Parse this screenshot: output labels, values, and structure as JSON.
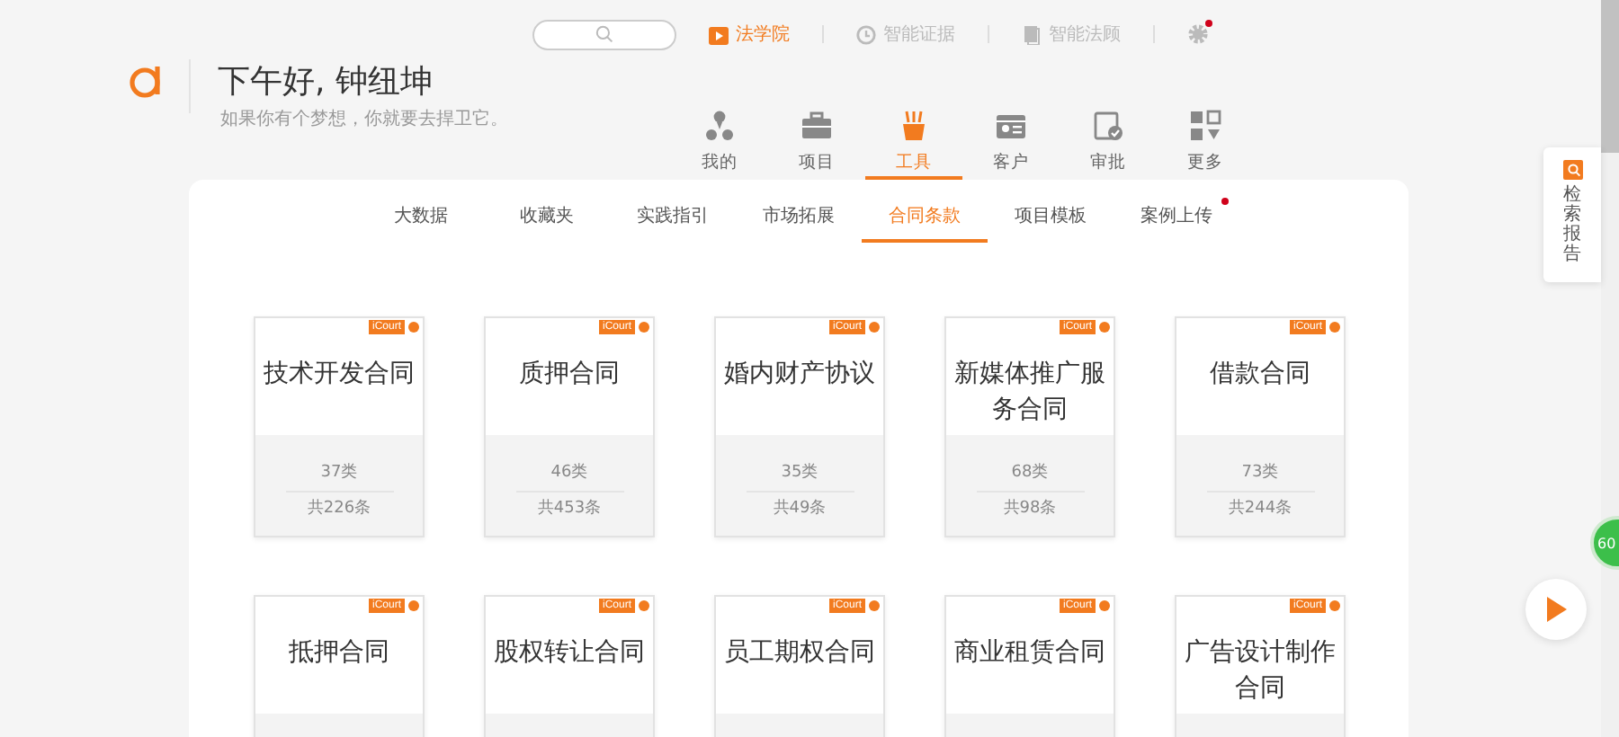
{
  "header": {
    "greeting": "下午好, 钟纽坤",
    "motto": "如果你有个梦想，你就要去捍卫它。"
  },
  "top_links": [
    {
      "label": "法学院",
      "selected": true
    },
    {
      "label": "智能证据",
      "selected": false
    },
    {
      "label": "智能法顾",
      "selected": false
    }
  ],
  "settings": {
    "notification": true
  },
  "nav": [
    {
      "label": "我的",
      "selected": false
    },
    {
      "label": "项目",
      "selected": false
    },
    {
      "label": "工具",
      "selected": true
    },
    {
      "label": "客户",
      "selected": false
    },
    {
      "label": "审批",
      "selected": false
    },
    {
      "label": "更多",
      "selected": false
    }
  ],
  "tabs": [
    {
      "label": "大数据",
      "selected": false,
      "dot": false
    },
    {
      "label": "收藏夹",
      "selected": false,
      "dot": false
    },
    {
      "label": "实践指引",
      "selected": false,
      "dot": false
    },
    {
      "label": "市场拓展",
      "selected": false,
      "dot": false
    },
    {
      "label": "合同条款",
      "selected": true,
      "dot": false
    },
    {
      "label": "项目模板",
      "selected": false,
      "dot": false
    },
    {
      "label": "案例上传",
      "selected": false,
      "dot": true
    }
  ],
  "cards": [
    {
      "title": "技术开发合同",
      "tag": "iCourt",
      "categories": "37类",
      "total": "共226条"
    },
    {
      "title": "质押合同",
      "tag": "iCourt",
      "categories": "46类",
      "total": "共453条"
    },
    {
      "title": "婚内财产协议",
      "tag": "iCourt",
      "categories": "35类",
      "total": "共49条"
    },
    {
      "title": "新媒体推广服务合同",
      "tag": "iCourt",
      "categories": "68类",
      "total": "共98条"
    },
    {
      "title": "借款合同",
      "tag": "iCourt",
      "categories": "73类",
      "total": "共244条"
    },
    {
      "title": "抵押合同",
      "tag": "iCourt"
    },
    {
      "title": "股权转让合同",
      "tag": "iCourt"
    },
    {
      "title": "员工期权合同",
      "tag": "iCourt"
    },
    {
      "title": "商业租赁合同",
      "tag": "iCourt"
    },
    {
      "title": "广告设计制作合同",
      "tag": "iCourt"
    }
  ],
  "side_panel": {
    "label": "检索报告"
  },
  "floating_badge": "60"
}
